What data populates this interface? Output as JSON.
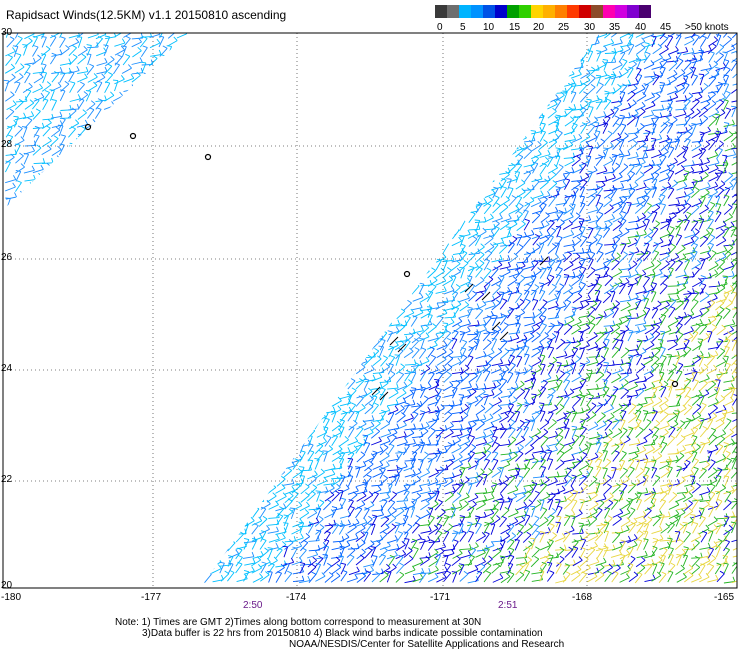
{
  "title": "Rapidsact Winds(12.5KM) v1.1 20150810 ascending",
  "legend": {
    "colors": [
      "#3a3a3a",
      "#6e6e6e",
      "#00b4ff",
      "#0092ff",
      "#0052e6",
      "#0000cc",
      "#00a000",
      "#2fd000",
      "#ffd400",
      "#ffb000",
      "#ff7f00",
      "#ff3a00",
      "#d00000",
      "#8c4b2a",
      "#ff00b0",
      "#d000e0",
      "#8000d0",
      "#4a0070"
    ],
    "labels": [
      "0",
      "5",
      "10",
      "15",
      "20",
      "25",
      "30",
      "35",
      "40",
      "45",
      ">50 knots"
    ]
  },
  "map": {
    "lat_labels": [
      "30",
      "28",
      "26",
      "24",
      "22",
      "20"
    ],
    "lon_labels": [
      "-180",
      "-177",
      "-174",
      "-171",
      "-168",
      "-165"
    ],
    "times": [
      "2:50",
      "2:51"
    ]
  },
  "notes": {
    "line1": "Note: 1) Times are GMT 2)Times along bottom correspond to measurement at 30N",
    "line2": "3)Data buffer is 22 hrs from 20150810 4) Black wind barbs indicate possible contamination",
    "line3": "NOAA/NESDIS/Center for Satellite Applications and Research"
  }
}
